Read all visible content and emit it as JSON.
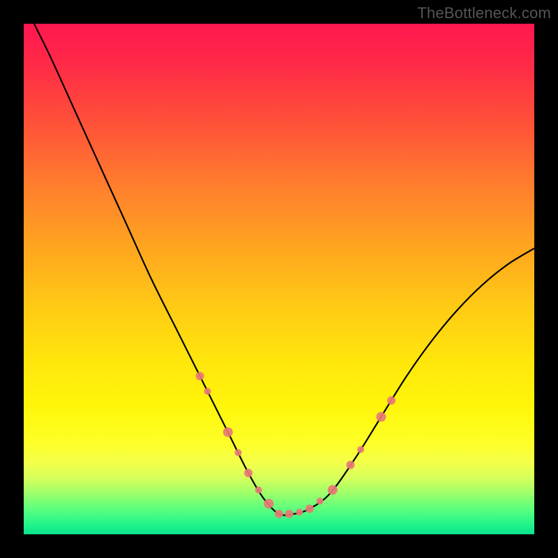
{
  "watermark": "TheBottleneck.com",
  "chart_data": {
    "type": "line",
    "title": "",
    "xlabel": "",
    "ylabel": "",
    "xlim": [
      0,
      1
    ],
    "ylim": [
      0,
      1
    ],
    "series": [
      {
        "name": "curve",
        "x": [
          0.0,
          0.05,
          0.1,
          0.15,
          0.2,
          0.25,
          0.3,
          0.35,
          0.4,
          0.44,
          0.47,
          0.5,
          0.53,
          0.56,
          0.6,
          0.65,
          0.7,
          0.75,
          0.8,
          0.85,
          0.9,
          0.95,
          1.0
        ],
        "values": [
          1.04,
          0.94,
          0.83,
          0.72,
          0.61,
          0.5,
          0.4,
          0.3,
          0.2,
          0.12,
          0.07,
          0.04,
          0.04,
          0.05,
          0.08,
          0.15,
          0.23,
          0.31,
          0.38,
          0.44,
          0.49,
          0.53,
          0.56
        ]
      }
    ],
    "markers": {
      "x": [
        0.345,
        0.36,
        0.4,
        0.42,
        0.44,
        0.46,
        0.48,
        0.5,
        0.52,
        0.54,
        0.56,
        0.58,
        0.605,
        0.64,
        0.66,
        0.7,
        0.72
      ],
      "r": [
        6,
        5,
        7,
        5,
        6,
        5,
        7,
        6,
        6,
        5,
        6,
        5,
        7,
        6,
        5,
        7,
        6
      ]
    },
    "gradient_stops": [
      {
        "pos": 0.0,
        "color": "#ff1750"
      },
      {
        "pos": 0.5,
        "color": "#ffcc14"
      },
      {
        "pos": 0.85,
        "color": "#feff27"
      },
      {
        "pos": 1.0,
        "color": "#0ae28c"
      }
    ]
  }
}
